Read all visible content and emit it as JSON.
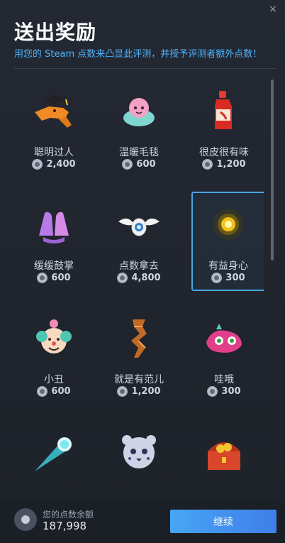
{
  "dialog": {
    "title": "送出奖励",
    "subtitle": "用您的 Steam 点数来凸显此评测，并授予评测者额外点数！",
    "close_glyph": "×"
  },
  "colors": {
    "accent": "#4fb3ff",
    "button_gradient_start": "#47a6f5",
    "button_gradient_end": "#3f7ee8",
    "selected_border": "#4aa7e6"
  },
  "awards": [
    {
      "name": "聪明过人",
      "price": "2,400",
      "icon": "graduate-dinosaur-icon"
    },
    {
      "name": "温暖毛毯",
      "price": "600",
      "icon": "blanket-creature-icon"
    },
    {
      "name": "很皮很有味",
      "price": "1,200",
      "icon": "hot-sauce-icon"
    },
    {
      "name": "缓缓鼓掌",
      "price": "600",
      "icon": "clapping-hands-icon"
    },
    {
      "name": "点数拿去",
      "price": "4,800",
      "icon": "winged-coin-icon"
    },
    {
      "name": "有益身心",
      "price": "300",
      "icon": "glowing-orb-icon",
      "selected": true
    },
    {
      "name": "小丑",
      "price": "600",
      "icon": "clown-icon"
    },
    {
      "name": "就是有范儿",
      "price": "1,200",
      "icon": "twisted-pillar-icon"
    },
    {
      "name": "哇哦",
      "price": "300",
      "icon": "wow-face-icon"
    },
    {
      "name": "",
      "price": "",
      "icon": "comet-icon"
    },
    {
      "name": "",
      "price": "",
      "icon": "leopard-icon"
    },
    {
      "name": "",
      "price": "",
      "icon": "treasure-chest-icon"
    }
  ],
  "footer": {
    "balance_label": "您的点数余额",
    "balance_value": "187,998",
    "continue_label": "继续"
  }
}
